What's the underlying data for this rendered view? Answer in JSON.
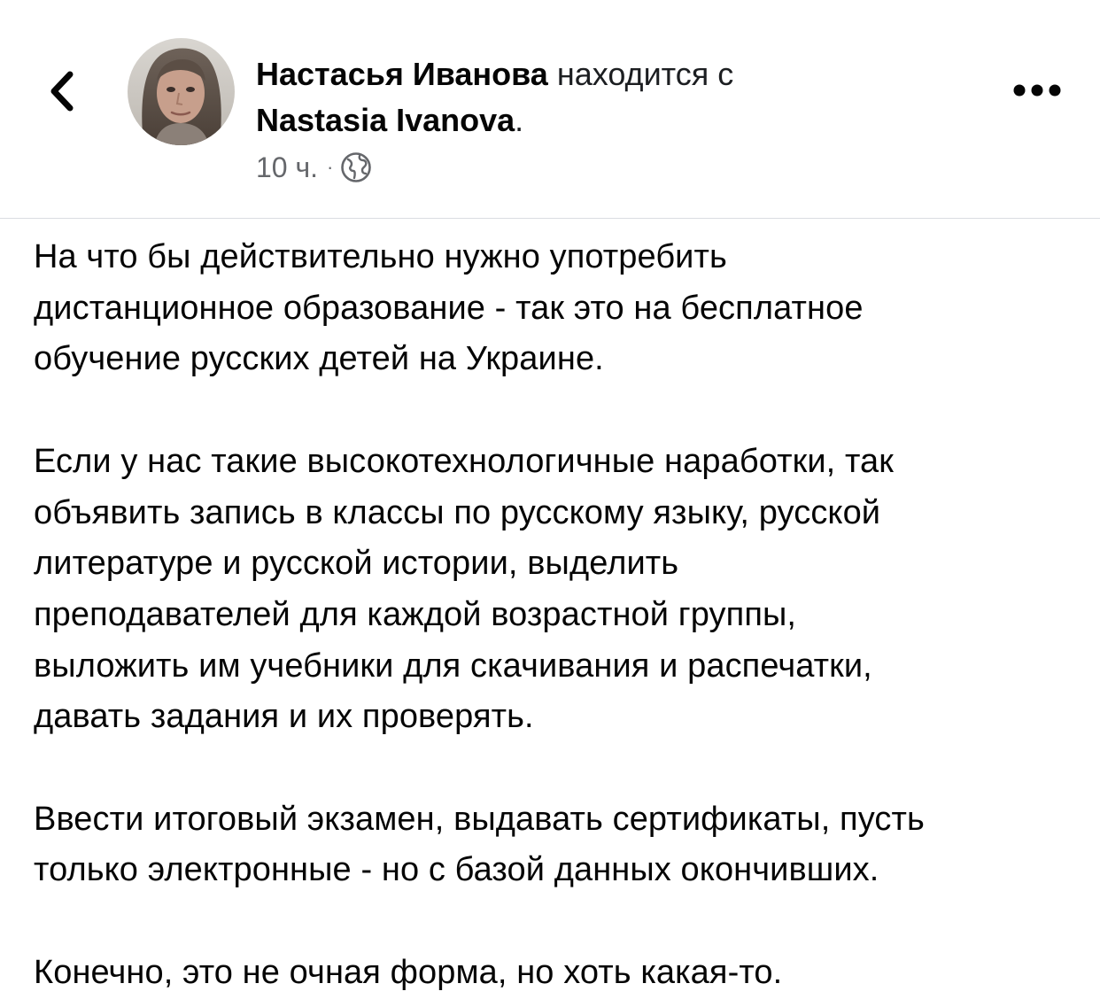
{
  "header": {
    "author_name": "Настасья Иванова",
    "with_text": " находится с ",
    "tagged_name": "Nastasia Ivanova",
    "tagged_suffix": ".",
    "time": "10 ч.",
    "separator": "·",
    "privacy_icon": "globe-icon",
    "back_icon": "chevron-left-icon",
    "more_icon": "more-horizontal-icon"
  },
  "post": {
    "paragraphs": [
      "На что бы действительно нужно употребить\nдистанционное образование - так это на бесплатное\nобучение русских детей на Украине.",
      "Если у нас такие высокотехнологичные наработки, так\nобъявить запись в классы по русскому языку, русской\nлитературе и русской истории, выделить\nпреподавателей для каждой возрастной группы,\nвыложить им учебники для скачивания и распечатки,\nдавать задания и их проверять.",
      "Ввести итоговый экзамен, выдавать сертификаты, пусть\nтолько электронные - но с базой данных окончивших.",
      "Конечно, это не очная форма, но хоть какая-то."
    ]
  },
  "colors": {
    "text": "#050505",
    "secondary": "#65676b",
    "divider": "#dadde1",
    "icon": "#050505"
  }
}
